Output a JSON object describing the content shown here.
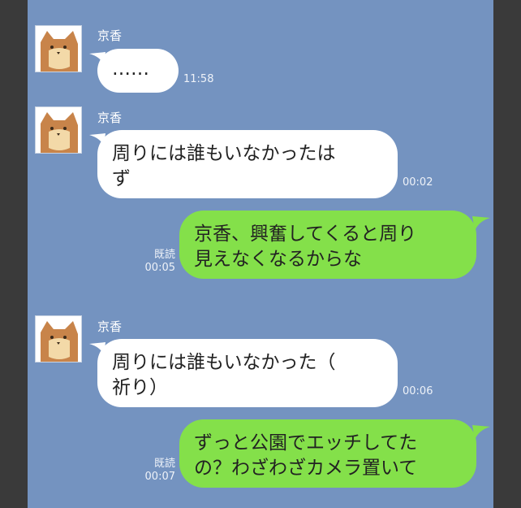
{
  "contact": {
    "name": "京香"
  },
  "messages": [
    {
      "side": "received",
      "text": "……",
      "time": "11:58"
    },
    {
      "side": "received",
      "line1": "周りには誰もいなかったは",
      "line2": "ず",
      "time": "00:02"
    },
    {
      "side": "sent",
      "line1": "京香、興奮してくると周り",
      "line2": "見えなくなるからな",
      "read": "既読",
      "time": "00:05"
    },
    {
      "side": "received",
      "line1": "周りには誰もいなかった（",
      "line2": "祈り）",
      "time": "00:06"
    },
    {
      "side": "sent",
      "line1": "ずっと公園でエッチしてた",
      "line2": "の？わざわざカメラ置いて",
      "read": "既読",
      "time": "00:07"
    }
  ],
  "colors": {
    "background": "#7493c0",
    "received_bubble": "#ffffff",
    "sent_bubble": "#84e04a",
    "frame": "#3a3a3a"
  },
  "icons": {
    "avatar": "cat-face-icon"
  }
}
